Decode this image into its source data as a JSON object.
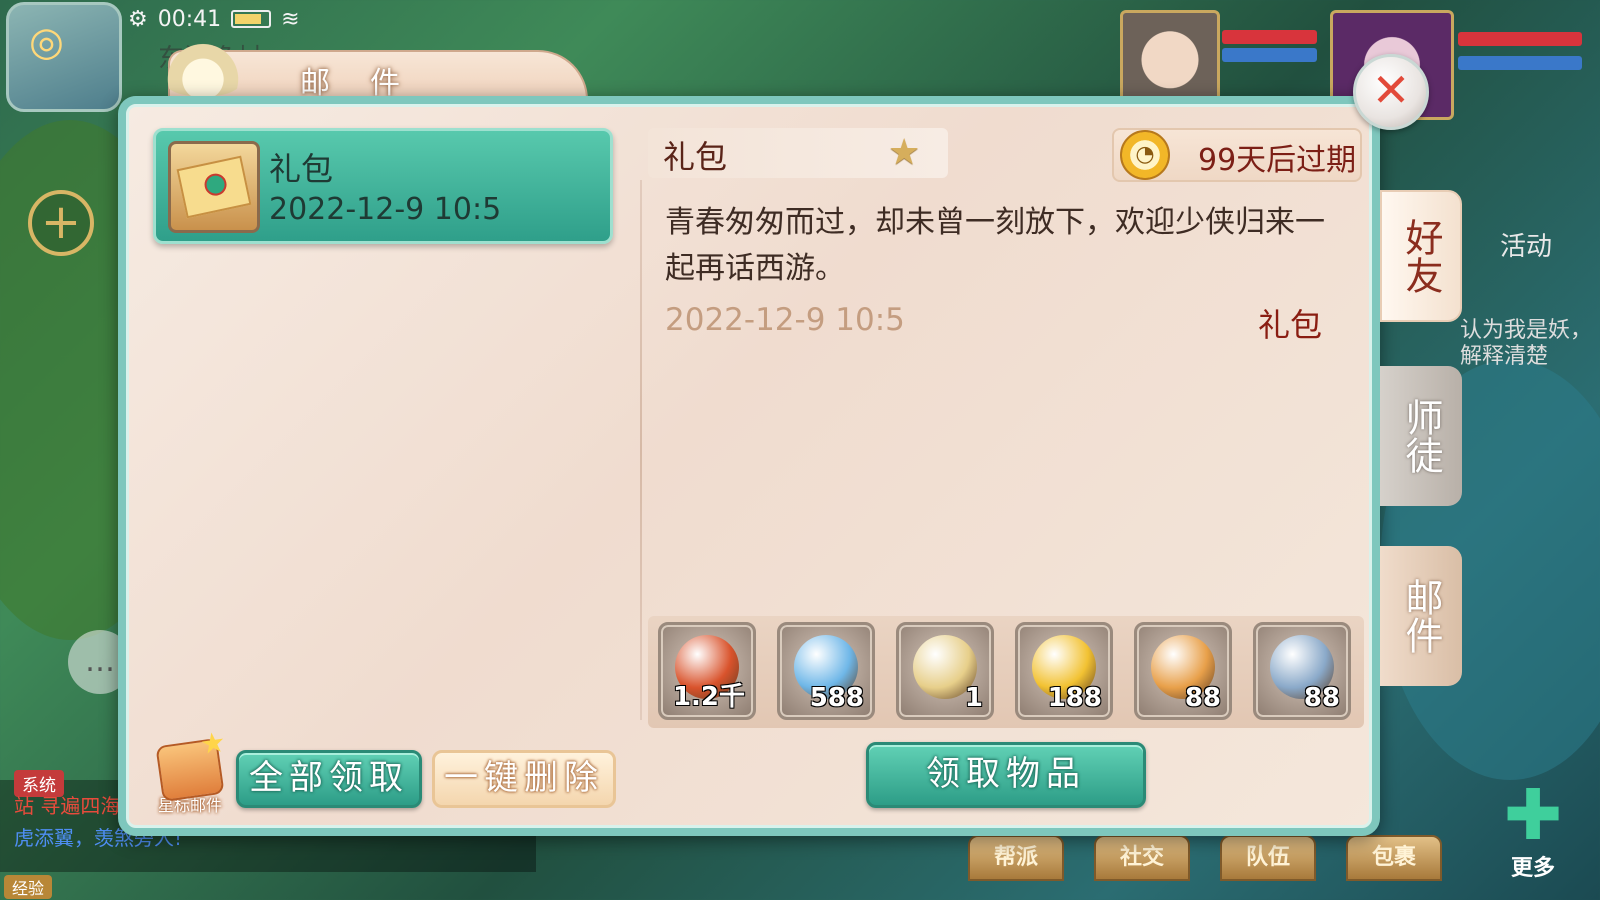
{
  "status_bar": {
    "time": "00:41"
  },
  "hud": {
    "location_partial": "东海渔村",
    "activity_label": "活动",
    "quest_text": "认为我是妖，解释清楚",
    "chat": {
      "channel_tag": "系统",
      "line1": "站 寻遍四海",
      "line2": "虎添翼，羡煞旁人!"
    },
    "exp_label": "经验",
    "bottom_menu": [
      "帮派",
      "社交",
      "队伍",
      "包裹"
    ],
    "more_label": "更多"
  },
  "dialog": {
    "title": "邮件",
    "close_icon": "close-icon",
    "mail_list": [
      {
        "title": "礼包",
        "date": "2022-12-9 10:5",
        "icon": "envelope-icon"
      }
    ],
    "detail": {
      "subject": "礼包",
      "expire_text": "99天后过期",
      "body": "青春匆匆而过，却未曾一刻放下，欢迎少侠归来一起再话西游。",
      "date": "2022-12-9 10:5",
      "sender": "礼包",
      "rewards": [
        {
          "name": "red-orb",
          "qty": "1.2千",
          "color": "#d9532c"
        },
        {
          "name": "rainbow-orb",
          "qty": "588",
          "color": "#6fb7e8"
        },
        {
          "name": "scroll",
          "qty": "1",
          "color": "#e7cf8a"
        },
        {
          "name": "gold-flower",
          "qty": "188",
          "color": "#f2c233"
        },
        {
          "name": "lucky-bag",
          "qty": "88",
          "color": "#e8a04a"
        },
        {
          "name": "treasure-chest",
          "qty": "88",
          "color": "#8aa9c9"
        }
      ],
      "claim_button": "领取物品"
    },
    "footer": {
      "starred_label": "星标邮件",
      "claim_all": "全部领取",
      "delete_all": "一键删除"
    },
    "side_tabs": {
      "friends": "好友",
      "mentor": "师徒",
      "mail": "邮件"
    }
  }
}
